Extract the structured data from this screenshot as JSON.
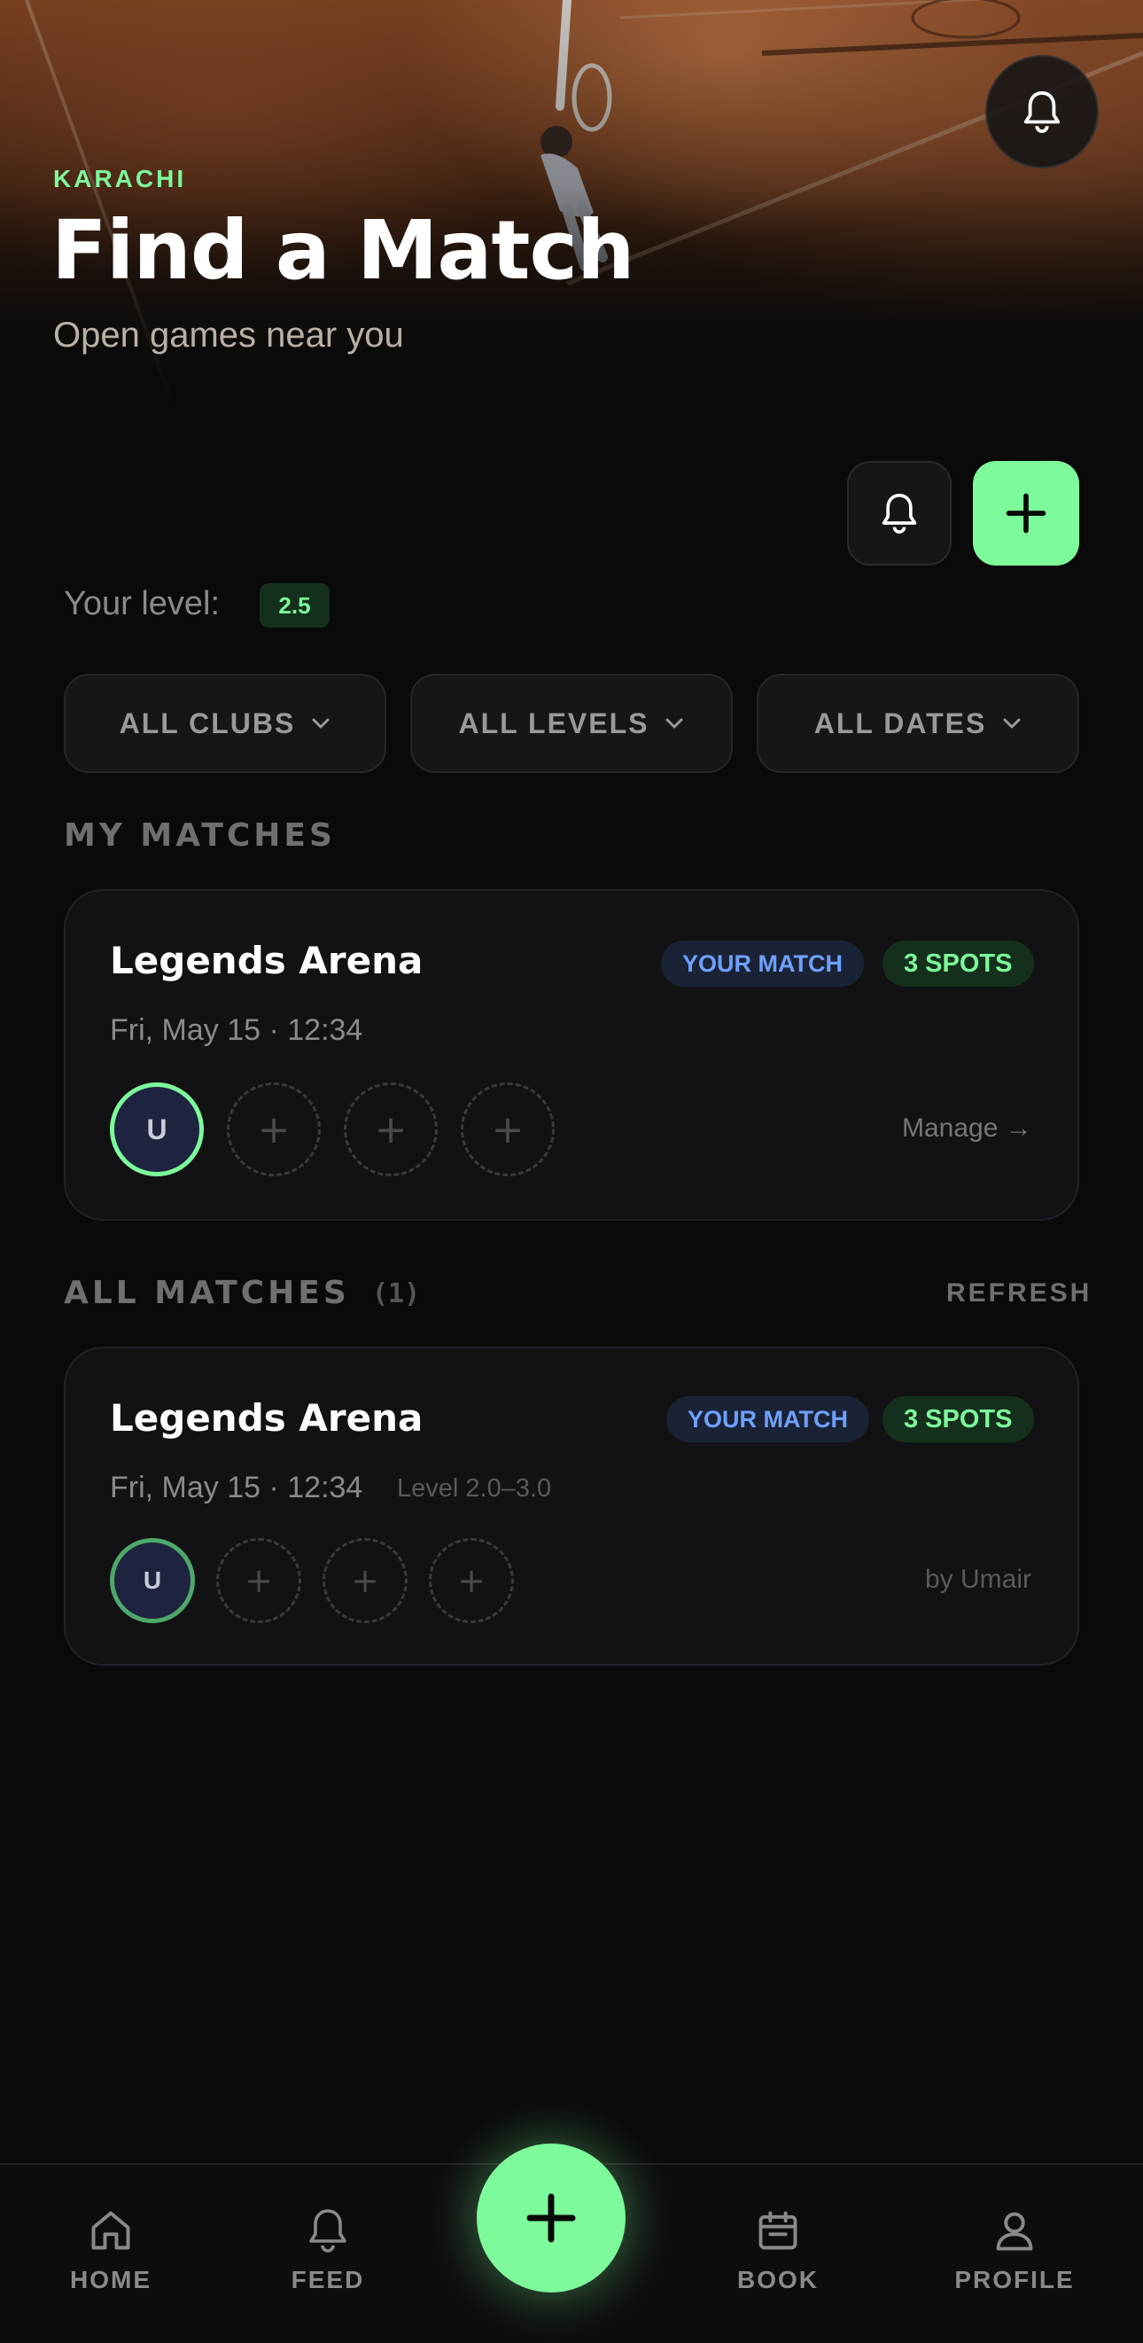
{
  "hero": {
    "city": "KARACHI",
    "title": "Find a Match",
    "subtitle": "Open games near you"
  },
  "level": {
    "label": "Your level:",
    "value": "2.5"
  },
  "filters": {
    "clubs": "ALL CLUBS",
    "levels": "ALL LEVELS",
    "dates": "ALL DATES"
  },
  "my_matches": {
    "title": "MY MATCHES",
    "card": {
      "club": "Legends Arena",
      "badge_your": "YOUR MATCH",
      "badge_spots": "3 SPOTS",
      "datetime": "Fri, May 15 · 12:34",
      "avatar_initial": "U",
      "slot_symbol": "+",
      "action": "Manage →"
    }
  },
  "all_matches": {
    "title": "ALL MATCHES",
    "count": "(1)",
    "refresh": "REFRESH",
    "card": {
      "club": "Legends Arena",
      "badge_your": "YOUR MATCH",
      "badge_spots": "3 SPOTS",
      "datetime": "Fri, May 15 · 12:34",
      "level_range": "Level 2.0–3.0",
      "avatar_initial": "U",
      "slot_symbol": "+",
      "organizer": "by Umair"
    }
  },
  "nav": {
    "home": "HOME",
    "feed": "FEED",
    "book": "BOOK",
    "profile": "PROFILE"
  },
  "colors": {
    "accent": "#7dfa9a",
    "background": "#0a0a0a",
    "badge_blue": "#6ea1ff"
  },
  "icons": [
    "bell-icon",
    "plus-icon",
    "chevron-down-icon",
    "home-icon",
    "calendar-icon",
    "user-icon"
  ]
}
